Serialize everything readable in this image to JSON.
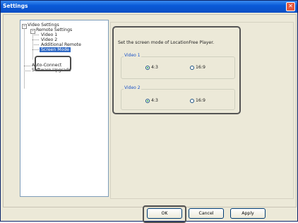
{
  "window": {
    "title": "Settings",
    "close_glyph": "✕"
  },
  "tree": {
    "items": [
      {
        "label": "Video Settings"
      },
      {
        "label": "Remote Settings"
      },
      {
        "label": "Video 1"
      },
      {
        "label": "Video 2"
      },
      {
        "label": "Additional Remote"
      },
      {
        "label": "Screen Mode"
      },
      {
        "label": "Auto-Connect"
      },
      {
        "label": "Software Upgrade"
      }
    ]
  },
  "panel": {
    "instruction": "Set the screen mode of LocationFree Player.",
    "groups": [
      {
        "label": "Video 1",
        "options": [
          "4:3",
          "16:9"
        ],
        "selected": "4:3"
      },
      {
        "label": "Video 2",
        "options": [
          "4:3",
          "16:9"
        ],
        "selected": "4:3"
      }
    ]
  },
  "buttons": {
    "ok": "OK",
    "cancel": "Cancel",
    "apply": "Apply"
  }
}
